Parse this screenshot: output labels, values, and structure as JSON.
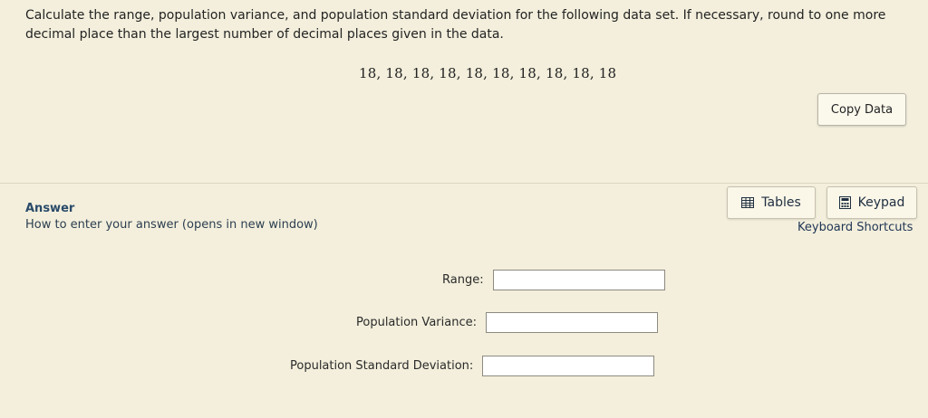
{
  "question": {
    "prompt": "Calculate the range, population variance, and population standard deviation for the following data set. If necessary, round to one more decimal place than the largest number of decimal places given in the data.",
    "data_set": "18, 18, 18, 18, 18, 18, 18, 18, 18, 18"
  },
  "buttons": {
    "copy_data": "Copy Data",
    "tables": "Tables",
    "keypad": "Keypad"
  },
  "answer": {
    "heading": "Answer",
    "how_to": "How to enter your answer (opens in new window)",
    "keyboard_shortcuts": "Keyboard Shortcuts"
  },
  "fields": {
    "range_label": "Range:",
    "variance_label": "Population Variance:",
    "std_dev_label": "Population Standard Deviation:",
    "range_value": "",
    "variance_value": "",
    "std_dev_value": ""
  },
  "icons": {
    "tables": "table-icon",
    "keypad": "calculator-icon"
  }
}
